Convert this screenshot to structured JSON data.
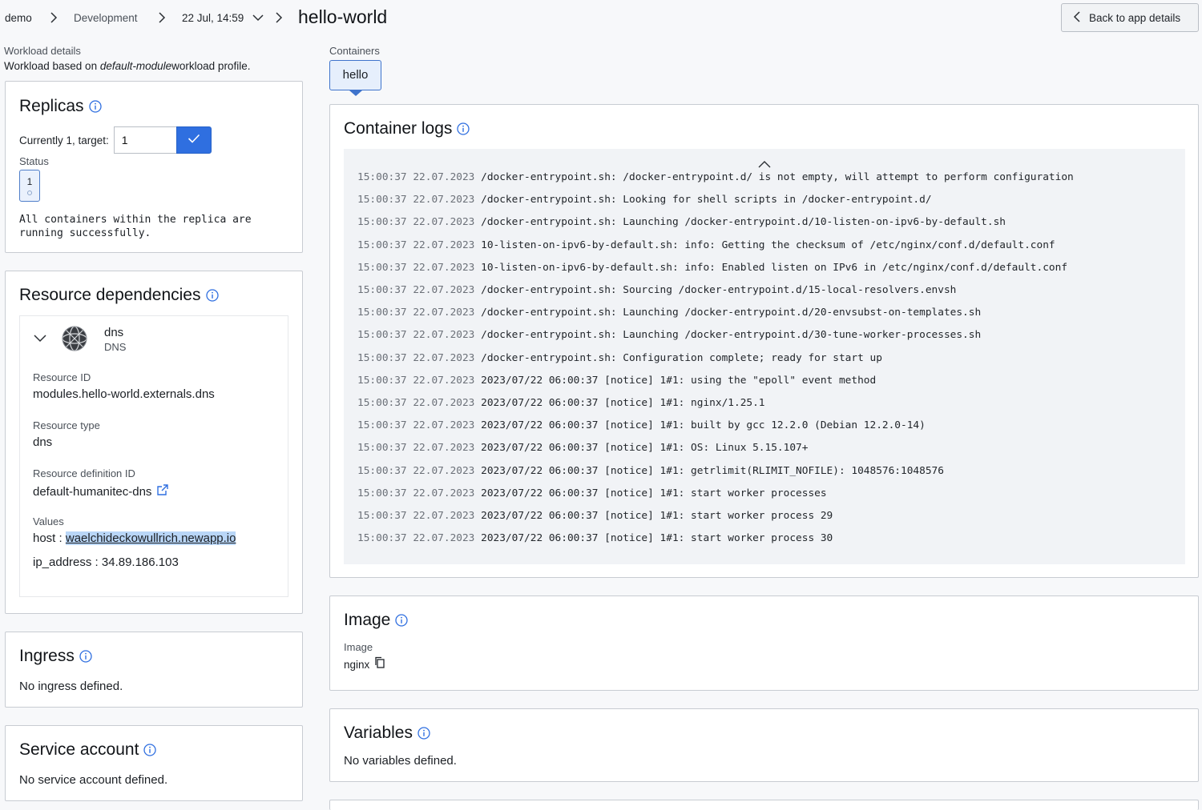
{
  "breadcrumb": {
    "org": "demo",
    "env": "Development",
    "deploy": "22 Jul, 14:59",
    "title": "hello-world"
  },
  "back_button": "Back to app details",
  "workload": {
    "label": "Workload details",
    "desc_prefix": "Workload based on",
    "desc_profile": "default-module",
    "desc_suffix": "workload profile."
  },
  "replicas": {
    "title": "Replicas",
    "target_label": "Currently 1, target:",
    "target_value": "1",
    "status_label": "Status",
    "chip_value": "1",
    "status_text_1": "All containers within the replica are",
    "status_text_2": "running successfully."
  },
  "deps": {
    "title": "Resource dependencies",
    "name": "dns",
    "type_small": "DNS",
    "id_label": "Resource ID",
    "id_value": "modules.hello-world.externals.dns",
    "type_label": "Resource type",
    "type_value": "dns",
    "def_label": "Resource definition ID",
    "def_value": "default-humanitec-dns",
    "values_label": "Values",
    "host_key": "host :",
    "host_value": "waelchideckowullrich.newapp.io",
    "ip_key": "ip_address :",
    "ip_value": "34.89.186.103"
  },
  "ingress": {
    "title": "Ingress",
    "text": "No ingress defined."
  },
  "service_account": {
    "title": "Service account",
    "text": "No service account defined."
  },
  "containers": {
    "label": "Containers",
    "tab": "hello"
  },
  "logs": {
    "title": "Container logs",
    "lines": [
      {
        "ts": "15:00:37 22.07.2023",
        "msg": "/docker-entrypoint.sh: /docker-entrypoint.d/ is not empty, will attempt to perform configuration"
      },
      {
        "ts": "15:00:37 22.07.2023",
        "msg": "/docker-entrypoint.sh: Looking for shell scripts in /docker-entrypoint.d/"
      },
      {
        "ts": "15:00:37 22.07.2023",
        "msg": "/docker-entrypoint.sh: Launching /docker-entrypoint.d/10-listen-on-ipv6-by-default.sh"
      },
      {
        "ts": "15:00:37 22.07.2023",
        "msg": "10-listen-on-ipv6-by-default.sh: info: Getting the checksum of /etc/nginx/conf.d/default.conf"
      },
      {
        "ts": "15:00:37 22.07.2023",
        "msg": "10-listen-on-ipv6-by-default.sh: info: Enabled listen on IPv6 in /etc/nginx/conf.d/default.conf"
      },
      {
        "ts": "15:00:37 22.07.2023",
        "msg": "/docker-entrypoint.sh: Sourcing /docker-entrypoint.d/15-local-resolvers.envsh"
      },
      {
        "ts": "15:00:37 22.07.2023",
        "msg": "/docker-entrypoint.sh: Launching /docker-entrypoint.d/20-envsubst-on-templates.sh"
      },
      {
        "ts": "15:00:37 22.07.2023",
        "msg": "/docker-entrypoint.sh: Launching /docker-entrypoint.d/30-tune-worker-processes.sh"
      },
      {
        "ts": "15:00:37 22.07.2023",
        "msg": "/docker-entrypoint.sh: Configuration complete; ready for start up"
      },
      {
        "ts": "15:00:37 22.07.2023",
        "msg": "2023/07/22 06:00:37 [notice] 1#1: using the \"epoll\" event method"
      },
      {
        "ts": "15:00:37 22.07.2023",
        "msg": "2023/07/22 06:00:37 [notice] 1#1: nginx/1.25.1"
      },
      {
        "ts": "15:00:37 22.07.2023",
        "msg": "2023/07/22 06:00:37 [notice] 1#1: built by gcc 12.2.0 (Debian 12.2.0-14)"
      },
      {
        "ts": "15:00:37 22.07.2023",
        "msg": "2023/07/22 06:00:37 [notice] 1#1: OS: Linux 5.15.107+"
      },
      {
        "ts": "15:00:37 22.07.2023",
        "msg": "2023/07/22 06:00:37 [notice] 1#1: getrlimit(RLIMIT_NOFILE): 1048576:1048576"
      },
      {
        "ts": "15:00:37 22.07.2023",
        "msg": "2023/07/22 06:00:37 [notice] 1#1: start worker processes"
      },
      {
        "ts": "15:00:37 22.07.2023",
        "msg": "2023/07/22 06:00:37 [notice] 1#1: start worker process 29"
      },
      {
        "ts": "15:00:37 22.07.2023",
        "msg": "2023/07/22 06:00:37 [notice] 1#1: start worker process 30"
      }
    ]
  },
  "image": {
    "title": "Image",
    "label": "Image",
    "value": "nginx"
  },
  "variables": {
    "title": "Variables",
    "text": "No variables defined."
  },
  "colors": {
    "accent": "#2f6fe0",
    "highlight": "#b9d6f7",
    "border": "#c8ccd2"
  },
  "icons": [
    "chevron-right-icon",
    "chevron-down-icon",
    "chevron-left-icon",
    "info-icon",
    "check-icon",
    "globe-icon",
    "external-link-icon",
    "copy-icon",
    "chevron-up-icon"
  ]
}
